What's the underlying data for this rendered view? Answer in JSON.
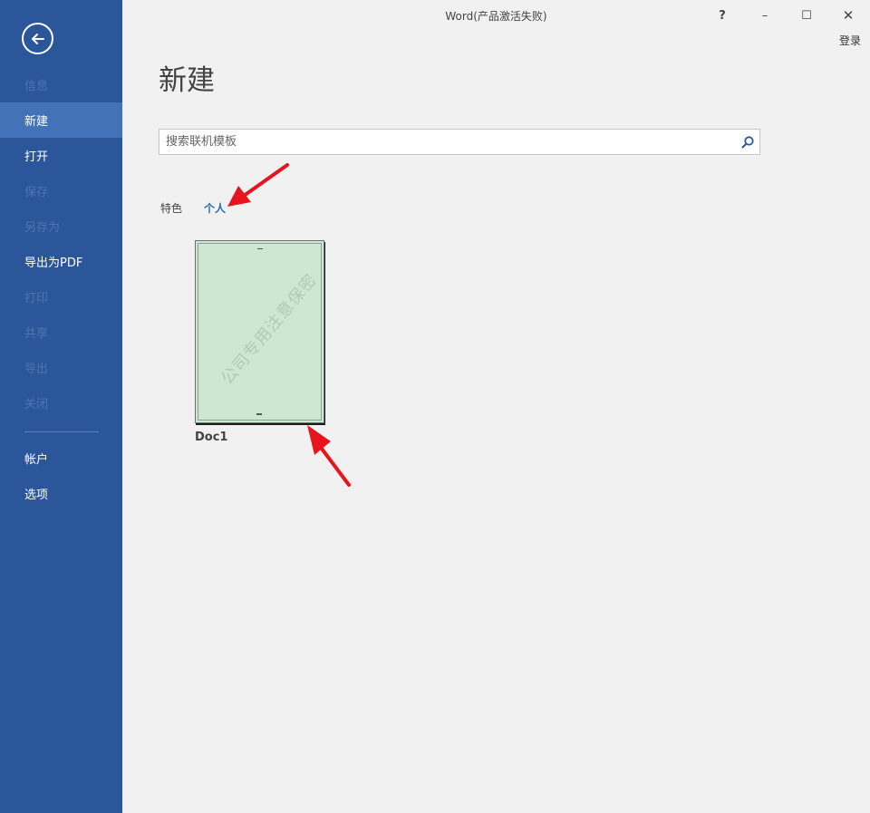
{
  "window": {
    "title": "Word(产品激活失败)",
    "help_label": "?",
    "minimize_label": "–",
    "maximize_label": "☐",
    "close_label": "✕",
    "login_label": "登录"
  },
  "sidebar": {
    "items": [
      {
        "label": "信息",
        "state": "disabled"
      },
      {
        "label": "新建",
        "state": "active"
      },
      {
        "label": "打开",
        "state": "enabled"
      },
      {
        "label": "保存",
        "state": "disabled"
      },
      {
        "label": "另存为",
        "state": "disabled"
      },
      {
        "label": "导出为PDF",
        "state": "enabled"
      },
      {
        "label": "打印",
        "state": "disabled"
      },
      {
        "label": "共享",
        "state": "disabled"
      },
      {
        "label": "导出",
        "state": "disabled"
      },
      {
        "label": "关闭",
        "state": "disabled"
      },
      {
        "label": "帐户",
        "state": "enabled"
      },
      {
        "label": "选项",
        "state": "enabled"
      }
    ]
  },
  "main": {
    "title": "新建",
    "search": {
      "placeholder": "搜索联机模板",
      "value": ""
    },
    "tabs": [
      {
        "label": "特色",
        "selected": false
      },
      {
        "label": "个人",
        "selected": true
      }
    ],
    "templates": [
      {
        "name": "Doc1",
        "watermark": "公司专用注意保密"
      }
    ]
  },
  "colors": {
    "sidebar_bg": "#2b579a",
    "sidebar_active": "#4472b8",
    "tab_selected": "#2b6cb3",
    "annotation_arrow": "#e8141b",
    "template_bg": "#cde8d1"
  },
  "icons": {
    "back": "back-arrow-icon",
    "search": "search-icon"
  }
}
